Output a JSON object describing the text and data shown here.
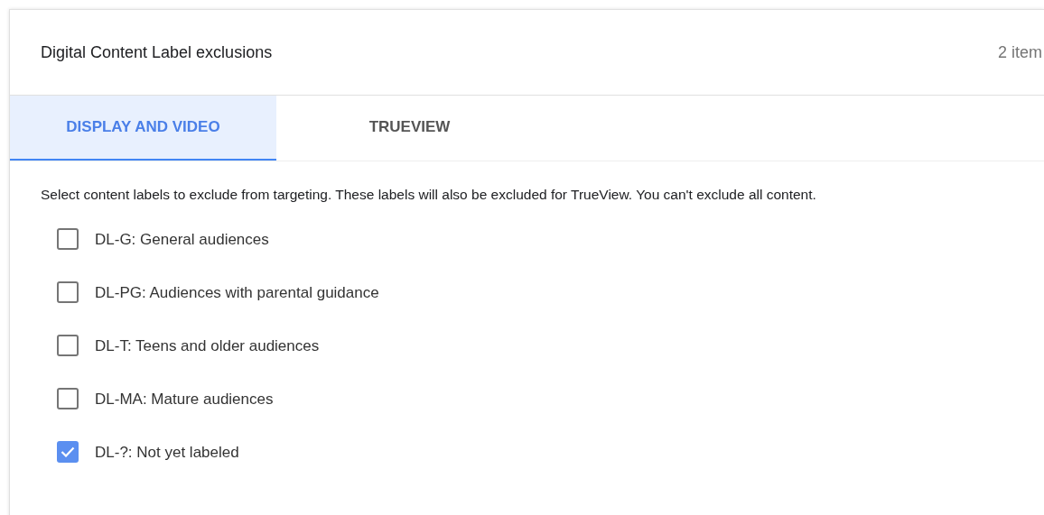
{
  "panel": {
    "title": "Digital Content Label exclusions",
    "count": "2 item"
  },
  "tabs": [
    {
      "label": "DISPLAY AND VIDEO",
      "selected": true
    },
    {
      "label": "TRUEVIEW",
      "selected": false
    }
  ],
  "description": "Select content labels to exclude from targeting. These labels will also be excluded for TrueView. You can't exclude all content.",
  "labels": [
    {
      "label": "DL-G: General audiences",
      "checked": false
    },
    {
      "label": "DL-PG: Audiences with parental guidance",
      "checked": false
    },
    {
      "label": "DL-T: Teens and older audiences",
      "checked": false
    },
    {
      "label": "DL-MA: Mature audiences",
      "checked": false
    },
    {
      "label": "DL-?: Not yet labeled",
      "checked": true
    }
  ]
}
